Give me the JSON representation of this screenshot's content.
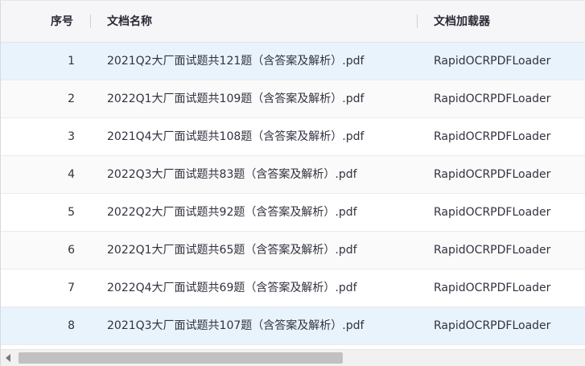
{
  "columns": {
    "index": "序号",
    "name": "文档名称",
    "loader": "文档加载器"
  },
  "rows": [
    {
      "index": "1",
      "name": "2021Q2大厂面试题共121题（含答案及解析）.pdf",
      "loader": "RapidOCRPDFLoader"
    },
    {
      "index": "2",
      "name": "2022Q1大厂面试题共109题（含答案及解析）.pdf",
      "loader": "RapidOCRPDFLoader"
    },
    {
      "index": "3",
      "name": "2021Q4大厂面试题共108题（含答案及解析）.pdf",
      "loader": "RapidOCRPDFLoader"
    },
    {
      "index": "4",
      "name": "2022Q3大厂面试题共83题（含答案及解析）.pdf",
      "loader": "RapidOCRPDFLoader"
    },
    {
      "index": "5",
      "name": "2022Q2大厂面试题共92题（含答案及解析）.pdf",
      "loader": "RapidOCRPDFLoader"
    },
    {
      "index": "6",
      "name": "2022Q1大厂面试题共65题（含答案及解析）.pdf",
      "loader": "RapidOCRPDFLoader"
    },
    {
      "index": "7",
      "name": "2022Q4大厂面试题共69题（含答案及解析）.pdf",
      "loader": "RapidOCRPDFLoader"
    },
    {
      "index": "8",
      "name": "2021Q3大厂面试题共107题（含答案及解析）.pdf",
      "loader": "RapidOCRPDFLoader"
    }
  ],
  "colors": {
    "header_bg": "#f6f6f9",
    "selected_row_bg": "#e9f3fc",
    "text": "#31333f"
  },
  "scrollbar": {
    "arrow_icon": "chevron-left-icon",
    "thumb_fraction": 0.57
  }
}
